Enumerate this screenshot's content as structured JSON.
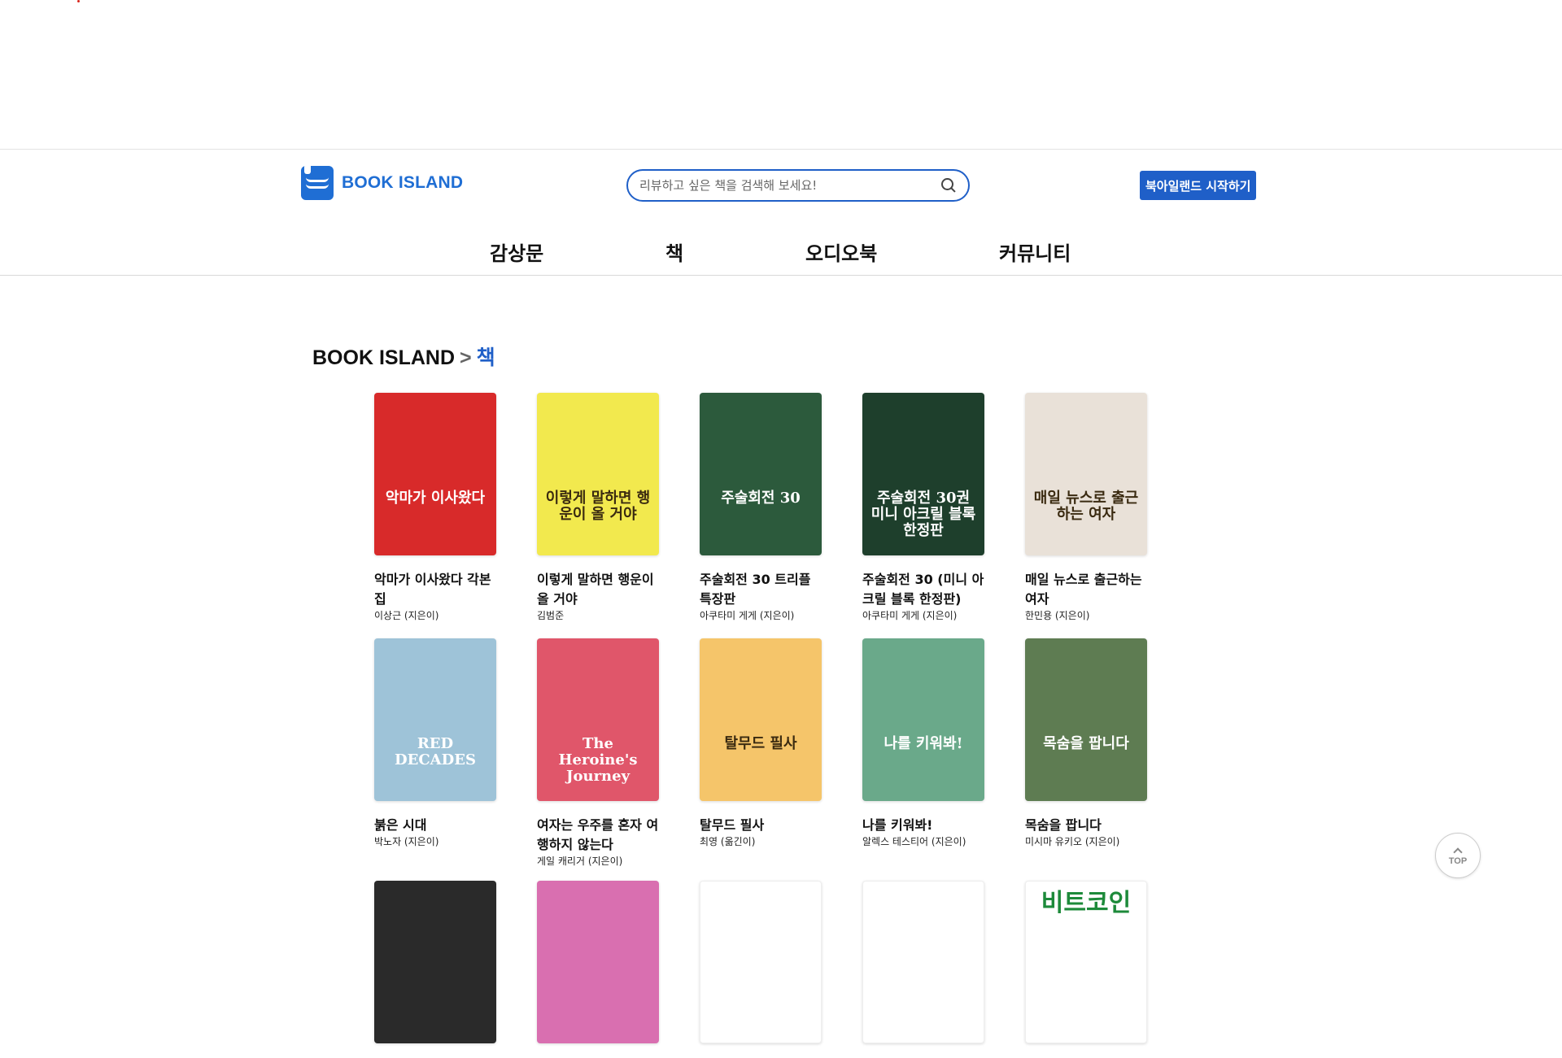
{
  "site": {
    "logo_text": "BOOK ISLAND"
  },
  "search": {
    "placeholder": "리뷰하고 싶은 책을 검색해 보세요!"
  },
  "header": {
    "start_button": "북아일랜드 시작하기"
  },
  "nav": {
    "items": [
      {
        "label": "감상문"
      },
      {
        "label": "책"
      },
      {
        "label": "오디오북"
      },
      {
        "label": "커뮤니티"
      }
    ]
  },
  "breadcrumb": {
    "root": "BOOK ISLAND",
    "separator": ">",
    "current": "책"
  },
  "books": [
    {
      "title": "악마가 이사왔다 각본집",
      "author": "이상근 (지은이)",
      "cover_text": "악마가 이사왔다",
      "cover_color": "#d82a2a"
    },
    {
      "title": "이렇게 말하면 행운이 올 거야",
      "author": "김범준",
      "cover_text": "이렇게 말하면 행운이 올 거야",
      "cover_color": "#f2e94e"
    },
    {
      "title": "주술회전 30 트리플 특장판",
      "author": "아쿠타미 게게 (지은이)",
      "cover_text": "주술회전 30",
      "cover_color": "#2c5a3c"
    },
    {
      "title": "주술회전 30 (미니 아크릴 블록 한정판)",
      "author": "아쿠타미 게게 (지은이)",
      "cover_text": "주술회전 30권 미니 아크릴 블록 한정판",
      "cover_color": "#1e3f2c"
    },
    {
      "title": "매일 뉴스로 출근하는 여자",
      "author": "한민용 (지은이)",
      "cover_text": "매일 뉴스로 출근하는 여자",
      "cover_color": "#e9e1d8"
    },
    {
      "title": "붉은 시대",
      "author": "박노자 (지은이)",
      "cover_text": "RED DECADES",
      "cover_color": "#9ec3d8"
    },
    {
      "title": "여자는 우주를 혼자 여행하지 않는다",
      "author": "게일 캐리거 (지은이)",
      "cover_text": "The Heroine's Journey",
      "cover_color": "#e0566a"
    },
    {
      "title": "탈무드 필사",
      "author": "최영 (옮긴이)",
      "cover_text": "탈무드 필사",
      "cover_color": "#f5c56a"
    },
    {
      "title": "나를 키워봐!",
      "author": "알렉스 테스티어 (지은이)",
      "cover_text": "나를 키워봐!",
      "cover_color": "#6aa98a"
    },
    {
      "title": "목숨을 팝니다",
      "author": "미시마 유키오 (지은이)",
      "cover_text": "목숨을 팝니다",
      "cover_color": "#5e7c52"
    },
    {
      "title": "",
      "author": "",
      "cover_text": "",
      "cover_color": "#2a2a2a"
    },
    {
      "title": "",
      "author": "",
      "cover_text": "",
      "cover_color": "#d96fb0"
    },
    {
      "title": "",
      "author": "",
      "cover_text": "",
      "cover_color": "#ffffff"
    },
    {
      "title": "",
      "author": "",
      "cover_text": "",
      "cover_color": "#ffffff"
    },
    {
      "title": "",
      "author": "",
      "cover_text": "비트코인",
      "cover_color": "#ffffff"
    }
  ],
  "top_button": {
    "label": "TOP"
  }
}
